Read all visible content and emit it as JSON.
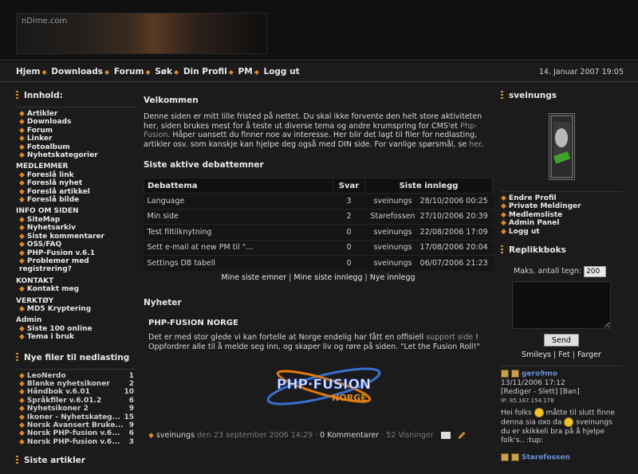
{
  "header": {
    "banner_logo": "nDime.com",
    "date": "14. Januar 2007 19:05"
  },
  "nav": [
    "Hjem",
    "Downloads",
    "Forum",
    "Søk",
    "Din Profil",
    "PM",
    "Logg ut"
  ],
  "left": {
    "innhold_title": "Innhold:",
    "menu": [
      {
        "type": "item",
        "label": "Artikler"
      },
      {
        "type": "item",
        "label": "Downloads"
      },
      {
        "type": "item",
        "label": "Forum"
      },
      {
        "type": "item",
        "label": "Linker"
      },
      {
        "type": "item",
        "label": "Fotoalbum"
      },
      {
        "type": "item",
        "label": "Nyhetskategorier"
      },
      {
        "type": "cat",
        "label": "MEDLEMMER"
      },
      {
        "type": "item",
        "label": "Foreslå link"
      },
      {
        "type": "item",
        "label": "Foreslå nyhet"
      },
      {
        "type": "item",
        "label": "Foreslå artikkel"
      },
      {
        "type": "item",
        "label": "Foreslå bilde"
      },
      {
        "type": "cat",
        "label": "INFO OM SIDEN"
      },
      {
        "type": "item",
        "label": "SiteMap"
      },
      {
        "type": "item",
        "label": "Nyhetsarkiv"
      },
      {
        "type": "item",
        "label": "Siste kommentarer"
      },
      {
        "type": "item",
        "label": "OSS/FAQ"
      },
      {
        "type": "item",
        "label": "PHP-Fusion v.6.1"
      },
      {
        "type": "item",
        "label": "Problemer med registrering?"
      },
      {
        "type": "cat",
        "label": "KONTAKT"
      },
      {
        "type": "item",
        "label": "Kontakt meg"
      },
      {
        "type": "cat",
        "label": "VERKTØY"
      },
      {
        "type": "item",
        "label": "MD5 Kryptering"
      },
      {
        "type": "cat",
        "label": "Admin"
      },
      {
        "type": "item",
        "label": "Siste 100 online"
      },
      {
        "type": "item",
        "label": "Tema i bruk"
      }
    ],
    "downloads_title": "Nye filer til nedlasting",
    "downloads": [
      {
        "name": "LeoNerdo",
        "count": "1"
      },
      {
        "name": "Blanke nyhetsikoner",
        "count": "2"
      },
      {
        "name": "Håndbok v.6.01",
        "count": "10"
      },
      {
        "name": "Språkfiler v.6.01.2",
        "count": "6"
      },
      {
        "name": "Nyhetsikoner 2",
        "count": "9"
      },
      {
        "name": "Ikoner - Nyhetskateg...",
        "count": "15"
      },
      {
        "name": "Norsk Avansert Bruke...",
        "count": "9"
      },
      {
        "name": "Norsk PHP-fusion v.6...",
        "count": "6"
      },
      {
        "name": "Norsk PHP-fusion v.6...",
        "count": "3"
      }
    ],
    "articles_title": "Siste artikler"
  },
  "main": {
    "welcome_title": "Velkommen",
    "welcome_text_1": "Denne siden er mitt lille fristed på nettet. Du skal ikke forvente den helt store aktiviteten her, siden brukes mest for å teste ut diverse tema og andre krumspring for CMS'et ",
    "welcome_link_1": "Php-Fusion",
    "welcome_text_2": ". Håper uansett du finner noe av interesse. Her blir det lagt til filer for nedlasting, artikler osv. som kanskje kan hjelpe deg også med DIN side. For vanlige spørsmål, se ",
    "welcome_link_2": "her",
    "welcome_text_3": ".",
    "forum_title": "Siste aktive debattemner",
    "forum_headers": [
      "Debattema",
      "Svar",
      "Siste innlegg"
    ],
    "forum_rows": [
      {
        "topic": "Language",
        "replies": "3",
        "user": "sveinungs",
        "date": "28/10/2006 00:25"
      },
      {
        "topic": "Min side",
        "replies": "2",
        "user": "Starefossen",
        "date": "27/10/2006 20:39"
      },
      {
        "topic": "Test filtilknytning",
        "replies": "0",
        "user": "sveinungs",
        "date": "22/08/2006 17:09"
      },
      {
        "topic": "Sett e-mail at new PM til \"...",
        "replies": "0",
        "user": "sveinungs",
        "date": "17/08/2006 20:04"
      },
      {
        "topic": "Settings DB tabell",
        "replies": "0",
        "user": "sveinungs",
        "date": "06/07/2006 21:23"
      }
    ],
    "forum_links": [
      "Mine siste emner",
      "Mine siste innlegg",
      "Nye innlegg"
    ],
    "news_head": "Nyheter",
    "news_title": "PHP-FUSION NORGE",
    "news_text_1": "Det er med stor glede vi kan fortelle at Norge endelig har fått en offisiell ",
    "news_link": "support side",
    "news_text_2": " ! Oppfordrer alle til å melde seg inn, og skaper liv og røre på siden. \"Let the Fusion Roll!\"",
    "news_logo_top": "PHP·FUSION",
    "news_logo_bottom": "NORGE",
    "news_author": "sveinungs",
    "news_date": "den 23 september 2006 14:29",
    "news_comments": "0 Kommentarer",
    "news_views": "52 Visninger"
  },
  "right": {
    "user_title": "sveinungs",
    "user_menu": [
      "Endre Profil",
      "Private Meldinger",
      "Medlemsliste",
      "Admin Panel",
      "Logg ut"
    ],
    "shout_title": "Replikkboks",
    "max_label": "Maks. antall tegn:",
    "max_value": "200",
    "send_label": "Send",
    "shout_links": [
      "Smileys",
      "Fet",
      "Farger"
    ],
    "shout1_user": "gero9mo",
    "shout1_date": "13/11/2006 17:12",
    "shout1_actions": "[Rediger - Slett] [Ban]",
    "shout1_ip": "IP: 85.167.154.178",
    "shout1_text_a": "Hei folks ",
    "shout1_text_b": " måtte til slutt finne denna sia oxo da",
    "shout1_text_c": " sveinungs du er skikkeli bra på å hjelpe folk's.. :tup:",
    "shout2_user": "Starefossen"
  },
  "colors": {
    "accent": "#d8892a",
    "background": "#1b1b1b",
    "shout_user": "#6a8fd6"
  }
}
